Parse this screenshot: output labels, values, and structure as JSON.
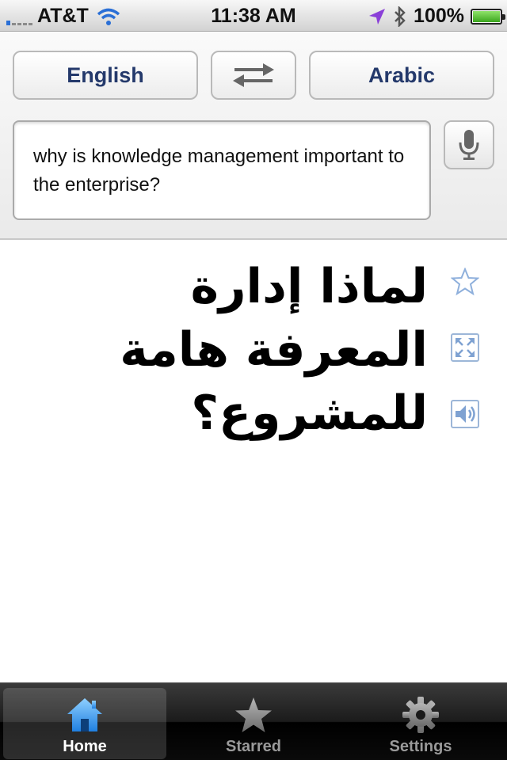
{
  "status_bar": {
    "carrier": "AT&T",
    "time": "11:38 AM",
    "battery": "100%",
    "battery_level": 1.0,
    "signal_bars": 1
  },
  "languages": {
    "source": "English",
    "target": "Arabic",
    "swap_icon": "swap-arrows-icon"
  },
  "input": {
    "text": "why is knowledge management important to the enterprise?",
    "mic_icon": "microphone-icon"
  },
  "result": {
    "text": "لماذا إدارة المعرفة هامة للمشروع؟",
    "icons": [
      "star-icon",
      "fullscreen-icon",
      "speaker-icon"
    ]
  },
  "tabs": [
    {
      "label": "Home",
      "icon": "home-icon",
      "active": true
    },
    {
      "label": "Starred",
      "icon": "star-icon",
      "active": false
    },
    {
      "label": "Settings",
      "icon": "gear-icon",
      "active": false
    }
  ],
  "colors": {
    "accent_blue": "#2a6fd6",
    "language_text": "#24396b",
    "icon_blue": "#9cb6d8"
  }
}
